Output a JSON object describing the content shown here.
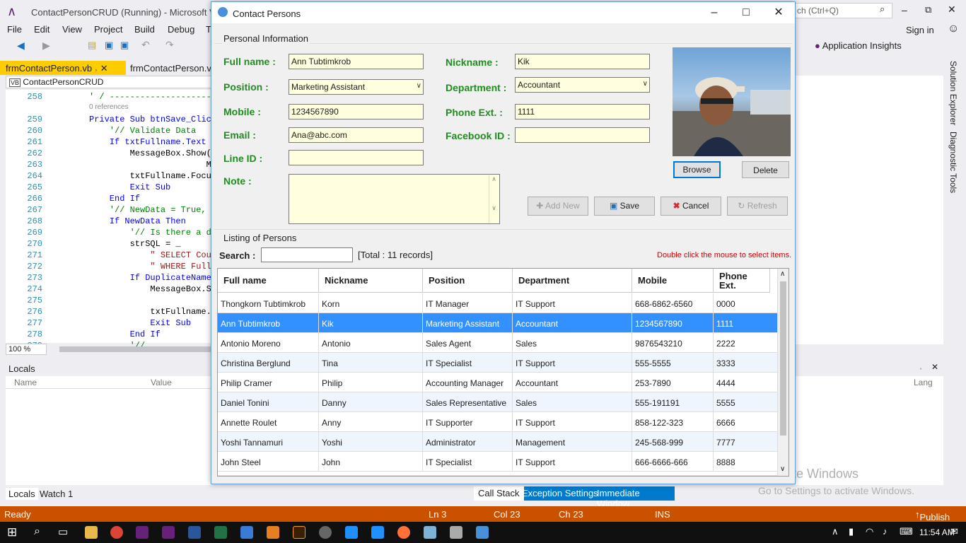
{
  "vs": {
    "title": "ContactPersonCRUD (Running) - Microsoft Visual",
    "search_placeholder": "ch (Ctrl+Q)",
    "menu": [
      "File",
      "Edit",
      "View",
      "Project",
      "Build",
      "Debug",
      "T"
    ],
    "sign_in": "Sign in",
    "app_insights": "Application Insights",
    "tabs": [
      "frmContactPerson.vb",
      "frmContactPerson.vb"
    ],
    "breadcrumb": "ContactPersonCRUD",
    "zoom": "100 %",
    "locals_title": "Locals",
    "locals_cols": [
      "Name",
      "Value",
      "Lang"
    ],
    "bottom_tabs": [
      "Locals",
      "Watch 1"
    ],
    "debug_tabs": [
      "Call Stack",
      "Exception Settings",
      "Immediate Window"
    ],
    "side_tabs": [
      "Solution Explorer",
      "Diagnostic Tools"
    ],
    "status": {
      "ready": "Ready",
      "ln": "Ln 3",
      "col": "Col 23",
      "ch": "Ch 23",
      "ins": "INS",
      "publish": "Publish"
    },
    "clock": "11:54 AM",
    "watermark_1": "Activate Windows",
    "watermark_2": "Go to Settings to activate Windows.",
    "code_lines": [
      {
        "n": "258",
        "t": "' / ------------------------"
      },
      {
        "n": "",
        "t": "0 references"
      },
      {
        "n": "259",
        "t": "Private Sub btnSave_Click"
      },
      {
        "n": "260",
        "t": "    '// Validate Data"
      },
      {
        "n": "261",
        "t": "    If txtFullname.Text ="
      },
      {
        "n": "262",
        "t": "        MessageBox.Show(\""
      },
      {
        "n": "263",
        "t": "                       M"
      },
      {
        "n": "264",
        "t": "        txtFullname.Focus"
      },
      {
        "n": "265",
        "t": "        Exit Sub"
      },
      {
        "n": "266",
        "t": "    End If"
      },
      {
        "n": "267",
        "t": "    '// NewData = True, I"
      },
      {
        "n": "268",
        "t": "    If NewData Then"
      },
      {
        "n": "269",
        "t": "        '// Is there a du"
      },
      {
        "n": "270",
        "t": "        strSQL = _"
      },
      {
        "n": "271",
        "t": "            \" SELECT Cour"
      },
      {
        "n": "272",
        "t": "            \" WHERE Fulln"
      },
      {
        "n": "273",
        "t": "        If DuplicateName("
      },
      {
        "n": "274",
        "t": "            MessageBox.Sh"
      },
      {
        "n": "275",
        "t": ""
      },
      {
        "n": "276",
        "t": "            txtFullname.F"
      },
      {
        "n": "277",
        "t": "            Exit Sub"
      },
      {
        "n": "278",
        "t": "        End If"
      },
      {
        "n": "279",
        "t": "        '//"
      }
    ]
  },
  "dialog": {
    "title": "Contact Persons",
    "group_personal": "Personal Information",
    "labels": {
      "fullname": "Full name :",
      "position": "Position :",
      "mobile": "Mobile :",
      "email": "Email :",
      "lineid": "Line ID :",
      "note": "Note :",
      "nickname": "Nickname :",
      "department": "Department :",
      "phoneext": "Phone Ext. :",
      "facebook": "Facebook ID :"
    },
    "values": {
      "fullname": "Ann Tubtimkrob",
      "position": "Marketing Assistant",
      "mobile": "1234567890",
      "email": "Ana@abc.com",
      "lineid": "",
      "note": "",
      "nickname": "Kik",
      "department": "Accountant",
      "phoneext": "1111",
      "facebook": ""
    },
    "buttons": {
      "browse": "Browse",
      "delete": "Delete",
      "addnew": "Add New",
      "save": "Save",
      "cancel": "Cancel",
      "refresh": "Refresh"
    },
    "group_listing": "Listing of Persons",
    "search_label": "Search :",
    "total": "[Total : 11 records]",
    "hint": "Double click the mouse to select items.",
    "columns": [
      "Full name",
      "Nickname",
      "Position",
      "Department",
      "Mobile",
      "Phone Ext."
    ],
    "rows": [
      [
        "Thongkorn Tubtimkrob",
        "Korn",
        "IT Manager",
        "IT Support",
        "668-6862-6560",
        "0000"
      ],
      [
        "Ann Tubtimkrob",
        "Kik",
        "Marketing Assistant",
        "Accountant",
        "1234567890",
        "1111"
      ],
      [
        "Antonio Moreno",
        "Antonio",
        "Sales Agent",
        "Sales",
        "9876543210",
        "2222"
      ],
      [
        "Christina Berglund",
        "Tina",
        "IT Specialist",
        "IT Support",
        "555-5555",
        "3333"
      ],
      [
        "Philip Cramer",
        "Philip",
        "Accounting Manager",
        "Accountant",
        "253-7890",
        "4444"
      ],
      [
        "Daniel Tonini",
        "Danny",
        "Sales Representative",
        "Sales",
        "555-191191",
        "5555"
      ],
      [
        "Annette Roulet",
        "Anny",
        "IT Supporter",
        "IT Support",
        "858-122-323",
        "6666"
      ],
      [
        "Yoshi Tannamuri",
        "Yoshi",
        "Administrator",
        "Management",
        "245-568-999",
        "7777"
      ],
      [
        "John Steel",
        "John",
        "IT Specialist",
        "IT Support",
        "666-6666-666",
        "8888"
      ]
    ],
    "selected_row": 1
  }
}
